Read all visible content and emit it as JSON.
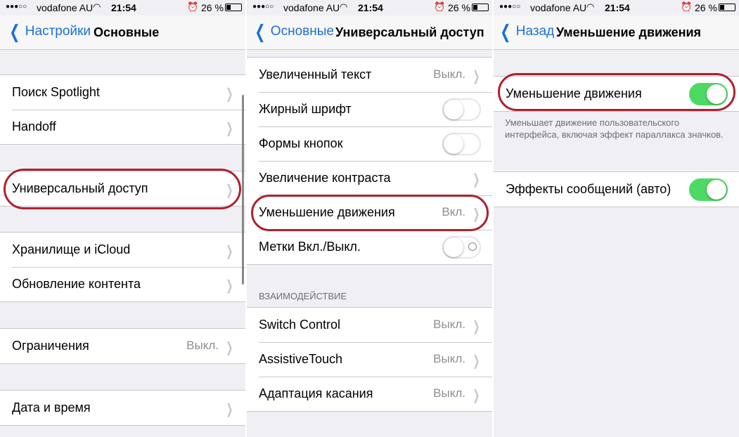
{
  "colors": {
    "accent": "#1c6fd6",
    "switch_on": "#4cd964",
    "highlight": "#b0202c",
    "background": "#efeff4"
  },
  "status_bar": {
    "carrier": "vodafone AU",
    "time": "21:54",
    "battery": "26 %",
    "signal_icon": "signal-dots-icon",
    "wifi_icon": "wifi-icon",
    "alarm_icon": "alarm-icon",
    "battery_icon": "battery-icon"
  },
  "screen1": {
    "back_label": "Настройки",
    "title": "Основные",
    "groups": [
      {
        "rows": [
          {
            "label": "Поиск Spotlight"
          },
          {
            "label": "Handoff"
          }
        ]
      },
      {
        "rows": [
          {
            "label": "Универсальный доступ"
          }
        ]
      },
      {
        "rows": [
          {
            "label": "Хранилище и iCloud"
          },
          {
            "label": "Обновление контента"
          }
        ]
      },
      {
        "rows": [
          {
            "label": "Ограничения",
            "value": "Выкл."
          }
        ]
      },
      {
        "rows": [
          {
            "label": "Дата и время"
          }
        ]
      }
    ]
  },
  "screen2": {
    "back_label": "Основные",
    "title": "Универсальный доступ",
    "rows": [
      {
        "label": "Увеличенный текст",
        "value": "Выкл."
      },
      {
        "label": "Жирный шрифт",
        "switch": "off"
      },
      {
        "label": "Формы кнопок",
        "switch": "off"
      },
      {
        "label": "Увеличение контраста"
      },
      {
        "label": "Уменьшение движения",
        "value": "Вкл."
      },
      {
        "label": "Метки Вкл./Выкл.",
        "switch": "off"
      }
    ],
    "section_header": "ВЗАИМОДЕЙСТВИЕ",
    "rows2": [
      {
        "label": "Switch Control",
        "value": "Выкл."
      },
      {
        "label": "AssistiveTouch",
        "value": "Выкл."
      },
      {
        "label": "Адаптация касания",
        "value": "Выкл."
      }
    ]
  },
  "screen3": {
    "back_label": "Назад",
    "title": "Уменьшение движения",
    "row1": {
      "label": "Уменьшение движения",
      "switch": "on"
    },
    "footer": "Уменьшает движение пользовательского интерфейса, включая эффект параллакса значков.",
    "row2": {
      "label": "Эффекты сообщений (авто)",
      "switch": "on"
    }
  }
}
